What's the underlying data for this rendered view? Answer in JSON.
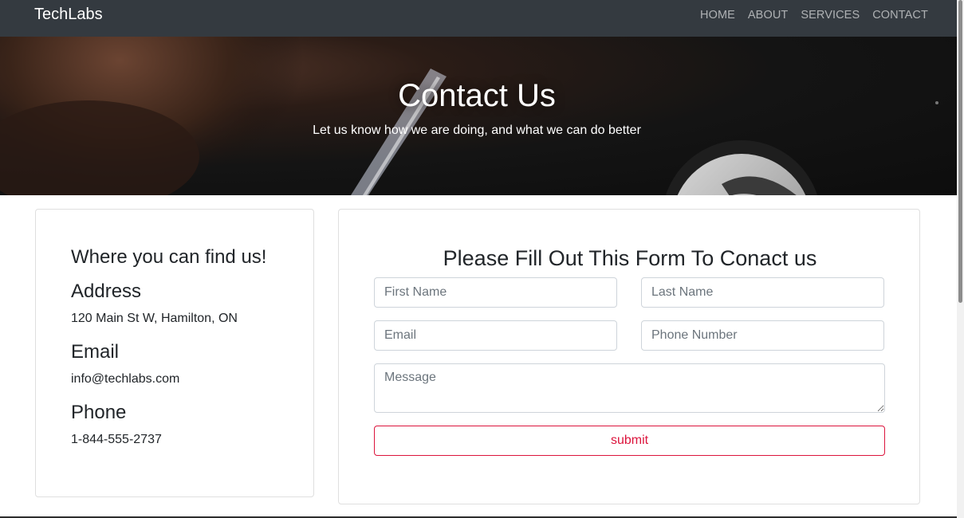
{
  "navbar": {
    "brand": "TechLabs",
    "links": [
      "HOME",
      "ABOUT",
      "SERVICES",
      "CONTACT"
    ]
  },
  "hero": {
    "title": "Contact Us",
    "subtitle": "Let us know how we are doing, and what we can do better"
  },
  "info": {
    "heading": "Where you can find us!",
    "address_label": "Address",
    "address_value": "120 Main St W, Hamilton, ON",
    "email_label": "Email",
    "email_value": "info@techlabs.com",
    "phone_label": "Phone",
    "phone_value": "1-844-555-2737"
  },
  "form": {
    "title": "Please Fill Out This Form To Conact us",
    "first_name_placeholder": "First Name",
    "last_name_placeholder": "Last Name",
    "email_placeholder": "Email",
    "phone_placeholder": "Phone Number",
    "message_placeholder": "Message",
    "submit_label": "submit"
  },
  "colors": {
    "navbar_bg": "#343a40",
    "accent": "#dc143c"
  }
}
